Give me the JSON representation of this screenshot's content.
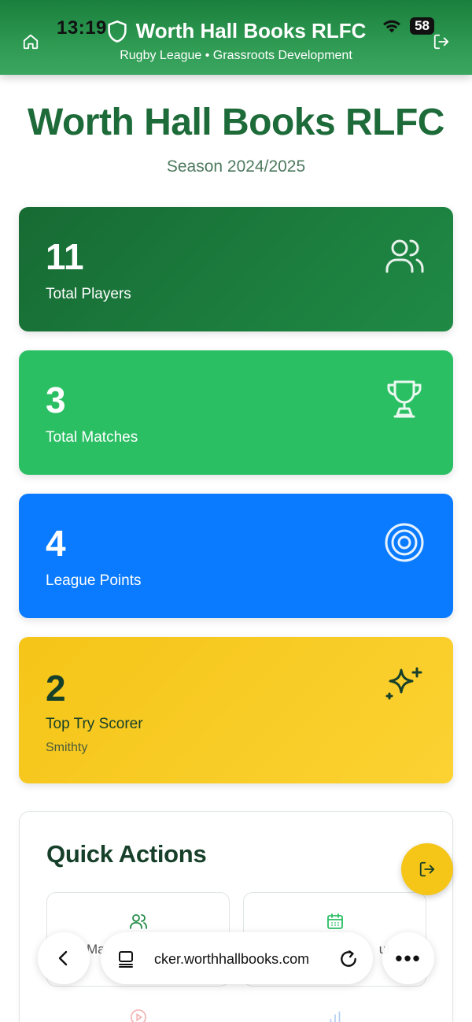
{
  "status_bar": {
    "time": "13:19",
    "battery": "58"
  },
  "header": {
    "title": "Worth Hall Books RLFC",
    "subtitle": "Rugby League • Grassroots Development"
  },
  "page": {
    "title": "Worth Hall Books RLFC",
    "season": "Season 2024/2025"
  },
  "stats": {
    "players": {
      "value": "11",
      "label": "Total Players",
      "icon": "users-icon",
      "color": "#1a7a3c"
    },
    "matches": {
      "value": "3",
      "label": "Total Matches",
      "icon": "trophy-icon",
      "color": "#2bbf64"
    },
    "points": {
      "value": "4",
      "label": "League Points",
      "icon": "target-icon",
      "color": "#0a7bff"
    },
    "scorer": {
      "value": "2",
      "label": "Top Try Scorer",
      "name": "Smithty",
      "icon": "sparkles-icon",
      "color": "#f5c518"
    }
  },
  "quick_actions": {
    "title": "Quick Actions",
    "tiles": [
      {
        "label": "Ma",
        "icon": "users-icon"
      },
      {
        "label": "ul",
        "icon": "calendar-icon"
      }
    ]
  },
  "browser": {
    "url": "cker.worthhallbooks.com",
    "more": "•••"
  }
}
